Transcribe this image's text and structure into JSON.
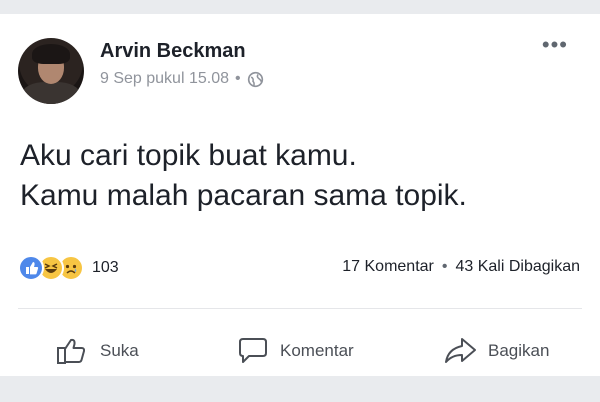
{
  "post": {
    "author": "Arvin Beckman",
    "timestamp": "9 Sep pukul 15.08",
    "separator": "•",
    "privacy_icon": "globe-icon",
    "more_label": "•••",
    "text_lines": [
      "Aku cari topik buat kamu.",
      "Kamu malah pacaran sama topik."
    ]
  },
  "reactions": {
    "icons": [
      "like-reaction-icon",
      "haha-reaction-icon",
      "sad-reaction-icon"
    ],
    "count": "103"
  },
  "stats": {
    "comments": "17 Komentar",
    "separator": "•",
    "shares": "43 Kali Dibagikan"
  },
  "actions": {
    "like": "Suka",
    "comment": "Komentar",
    "share": "Bagikan"
  },
  "colors": {
    "like_blue": "#4e88ea",
    "reaction_yellow": "#f7c543",
    "text": "#1d2129",
    "muted": "#90949c"
  }
}
